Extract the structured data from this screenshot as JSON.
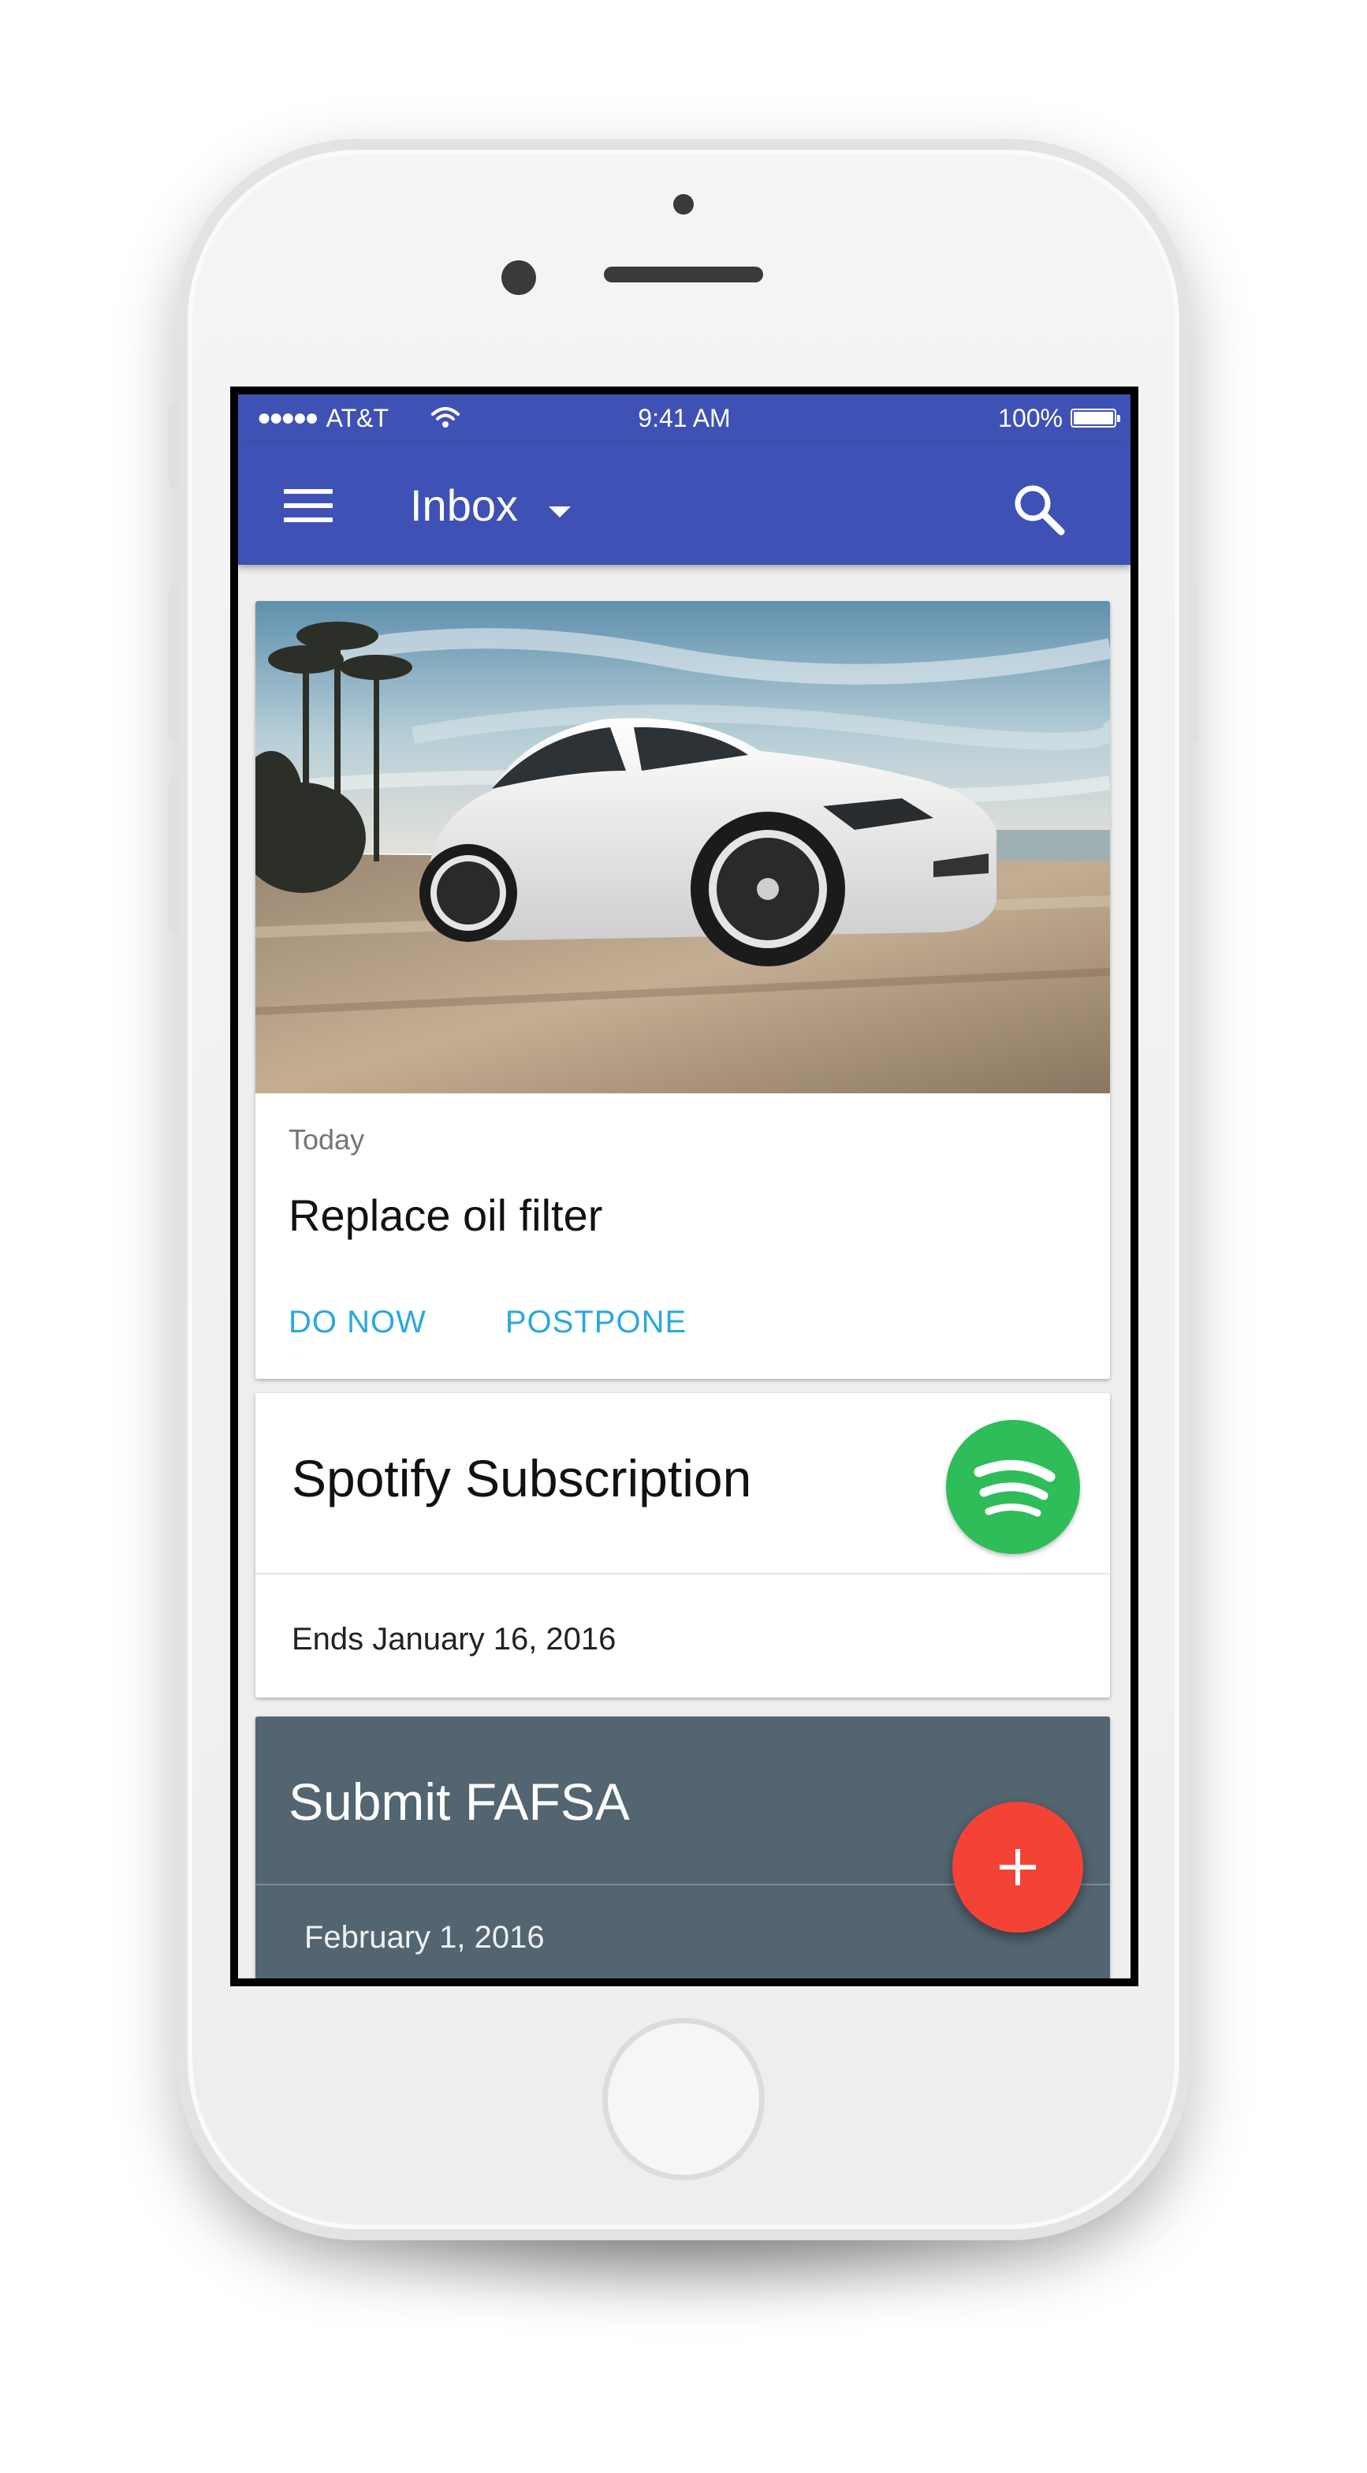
{
  "status_bar": {
    "signal": "●●●●●",
    "carrier": "AT&T",
    "time": "9:41 AM",
    "battery": "100%",
    "icons": [
      "wifi-icon",
      "battery-icon"
    ]
  },
  "app_bar": {
    "title": "Inbox",
    "icons": [
      "menu-icon",
      "dropdown-caret-icon",
      "search-icon"
    ]
  },
  "cards": [
    {
      "image": "white sports car on road with palm trees",
      "meta": "Today",
      "title": "Replace oil filter",
      "actions": [
        "DO NOW",
        "POSTPONE"
      ]
    },
    {
      "title": "Spotify Subscription",
      "icon": "spotify-logo-icon",
      "meta": "Ends January 16, 2016"
    },
    {
      "title": "Submit FAFSA",
      "meta": "February 1, 2016"
    }
  ],
  "fab": {
    "icon": "plus-icon"
  },
  "colors": {
    "primary": "#3f51b5",
    "accent_action": "#29a8e0",
    "spotify_green": "#2ebd59",
    "dark_card": "#526571",
    "fab": "#f44336"
  }
}
